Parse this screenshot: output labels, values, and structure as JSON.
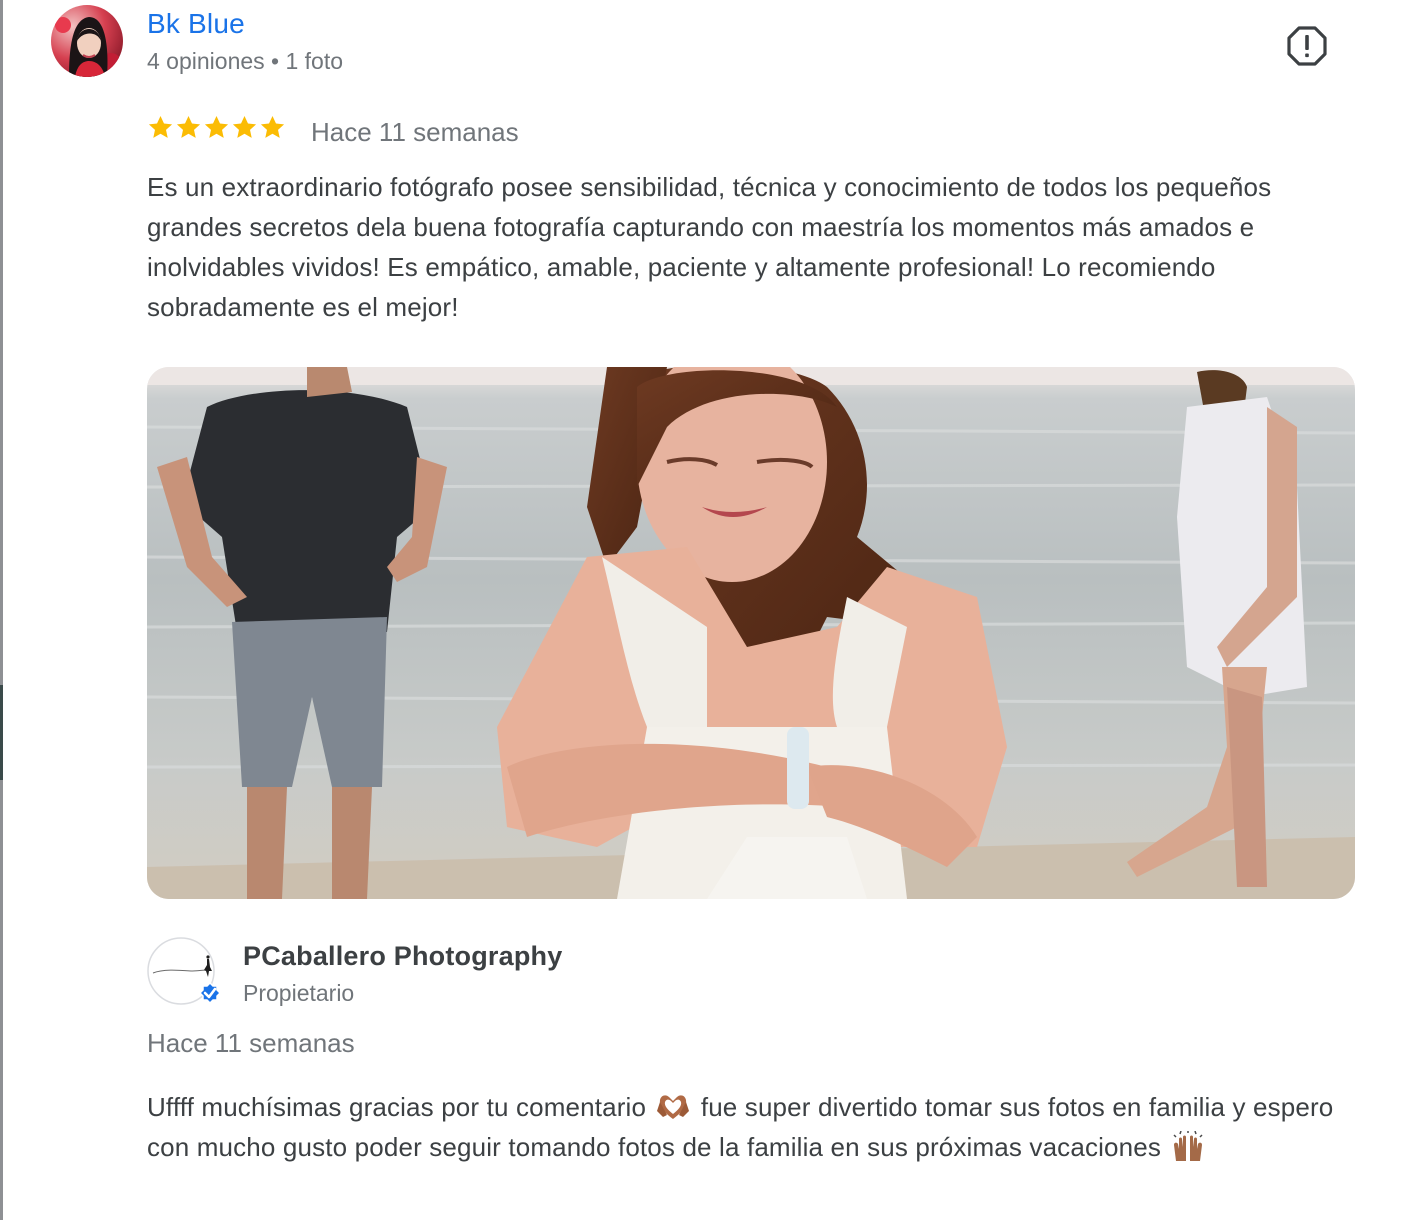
{
  "review": {
    "reviewer_name": "Bk Blue",
    "reviewer_meta": "4 opiniones • 1 foto",
    "rating": 5,
    "max_rating": 5,
    "time": "Hace 11 semanas",
    "text": "Es un extraordinario fotógrafo posee sensibilidad, técnica y conocimiento de todos los pequeños grandes secretos dela buena fotografía capturando con maestría los momentos más amados e inolvidables vividos! Es empático, amable, paciente y altamente profesional! Lo recomiendo sobradamente es el mejor!",
    "icons": {
      "report": "report-flag-icon",
      "star": "star-icon"
    },
    "colors": {
      "name": "#1a73e8",
      "star": "#fbbc04"
    }
  },
  "owner_reply": {
    "owner_name": "PCaballero Photography",
    "owner_role": "Propietario",
    "time": "Hace 11 semanas",
    "text_part1": "Uffff muchísimas gracias por tu comentario",
    "text_part2": "fue super divertido tomar sus fotos en familia y espero con mucho gusto poder seguir tomando fotos de la familia en sus próximas vacaciones",
    "icons": {
      "verified": "verified-check-icon",
      "emoji_1": "heart-hands-icon",
      "emoji_2": "raising-hands-icon"
    },
    "colors": {
      "verified": "#1a73e8"
    }
  }
}
